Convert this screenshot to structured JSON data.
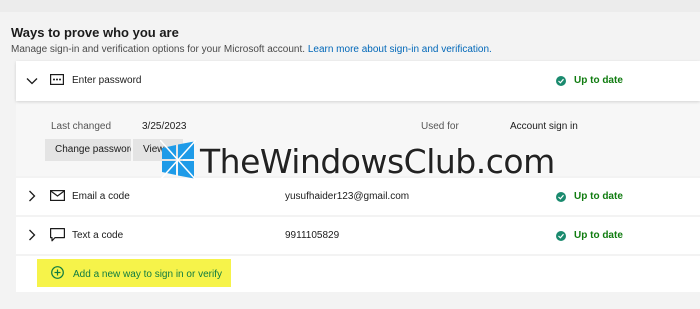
{
  "section": {
    "title": "Ways to prove who you are",
    "description": "Manage sign-in and verification options for your Microsoft account.",
    "link": "Learn more about sign-in and verification."
  },
  "methods": [
    {
      "icon": "password-icon",
      "label": "Enter password",
      "value": "",
      "status": "Up to date",
      "expanded": true
    },
    {
      "icon": "envelope-icon",
      "label": "Email a code",
      "value": "yusufhaider123@gmail.com",
      "status": "Up to date",
      "expanded": false
    },
    {
      "icon": "chat-icon",
      "label": "Text a code",
      "value": "9911105829",
      "status": "Up to date",
      "expanded": false
    }
  ],
  "password_details": {
    "last_changed_label": "Last changed",
    "last_changed_value": "3/25/2023",
    "used_for_label": "Used for",
    "used_for_value": "Account sign in",
    "change_button": "Change password",
    "view_button": "View"
  },
  "add_method": {
    "label": "Add a new way to sign in or verify",
    "highlight_color": "#f6f34a"
  },
  "watermark": "TheWindowsClub.com",
  "colors": {
    "status_green": "#107c10",
    "status_icon": "#1a8a6e",
    "link_blue": "#0067b8"
  }
}
